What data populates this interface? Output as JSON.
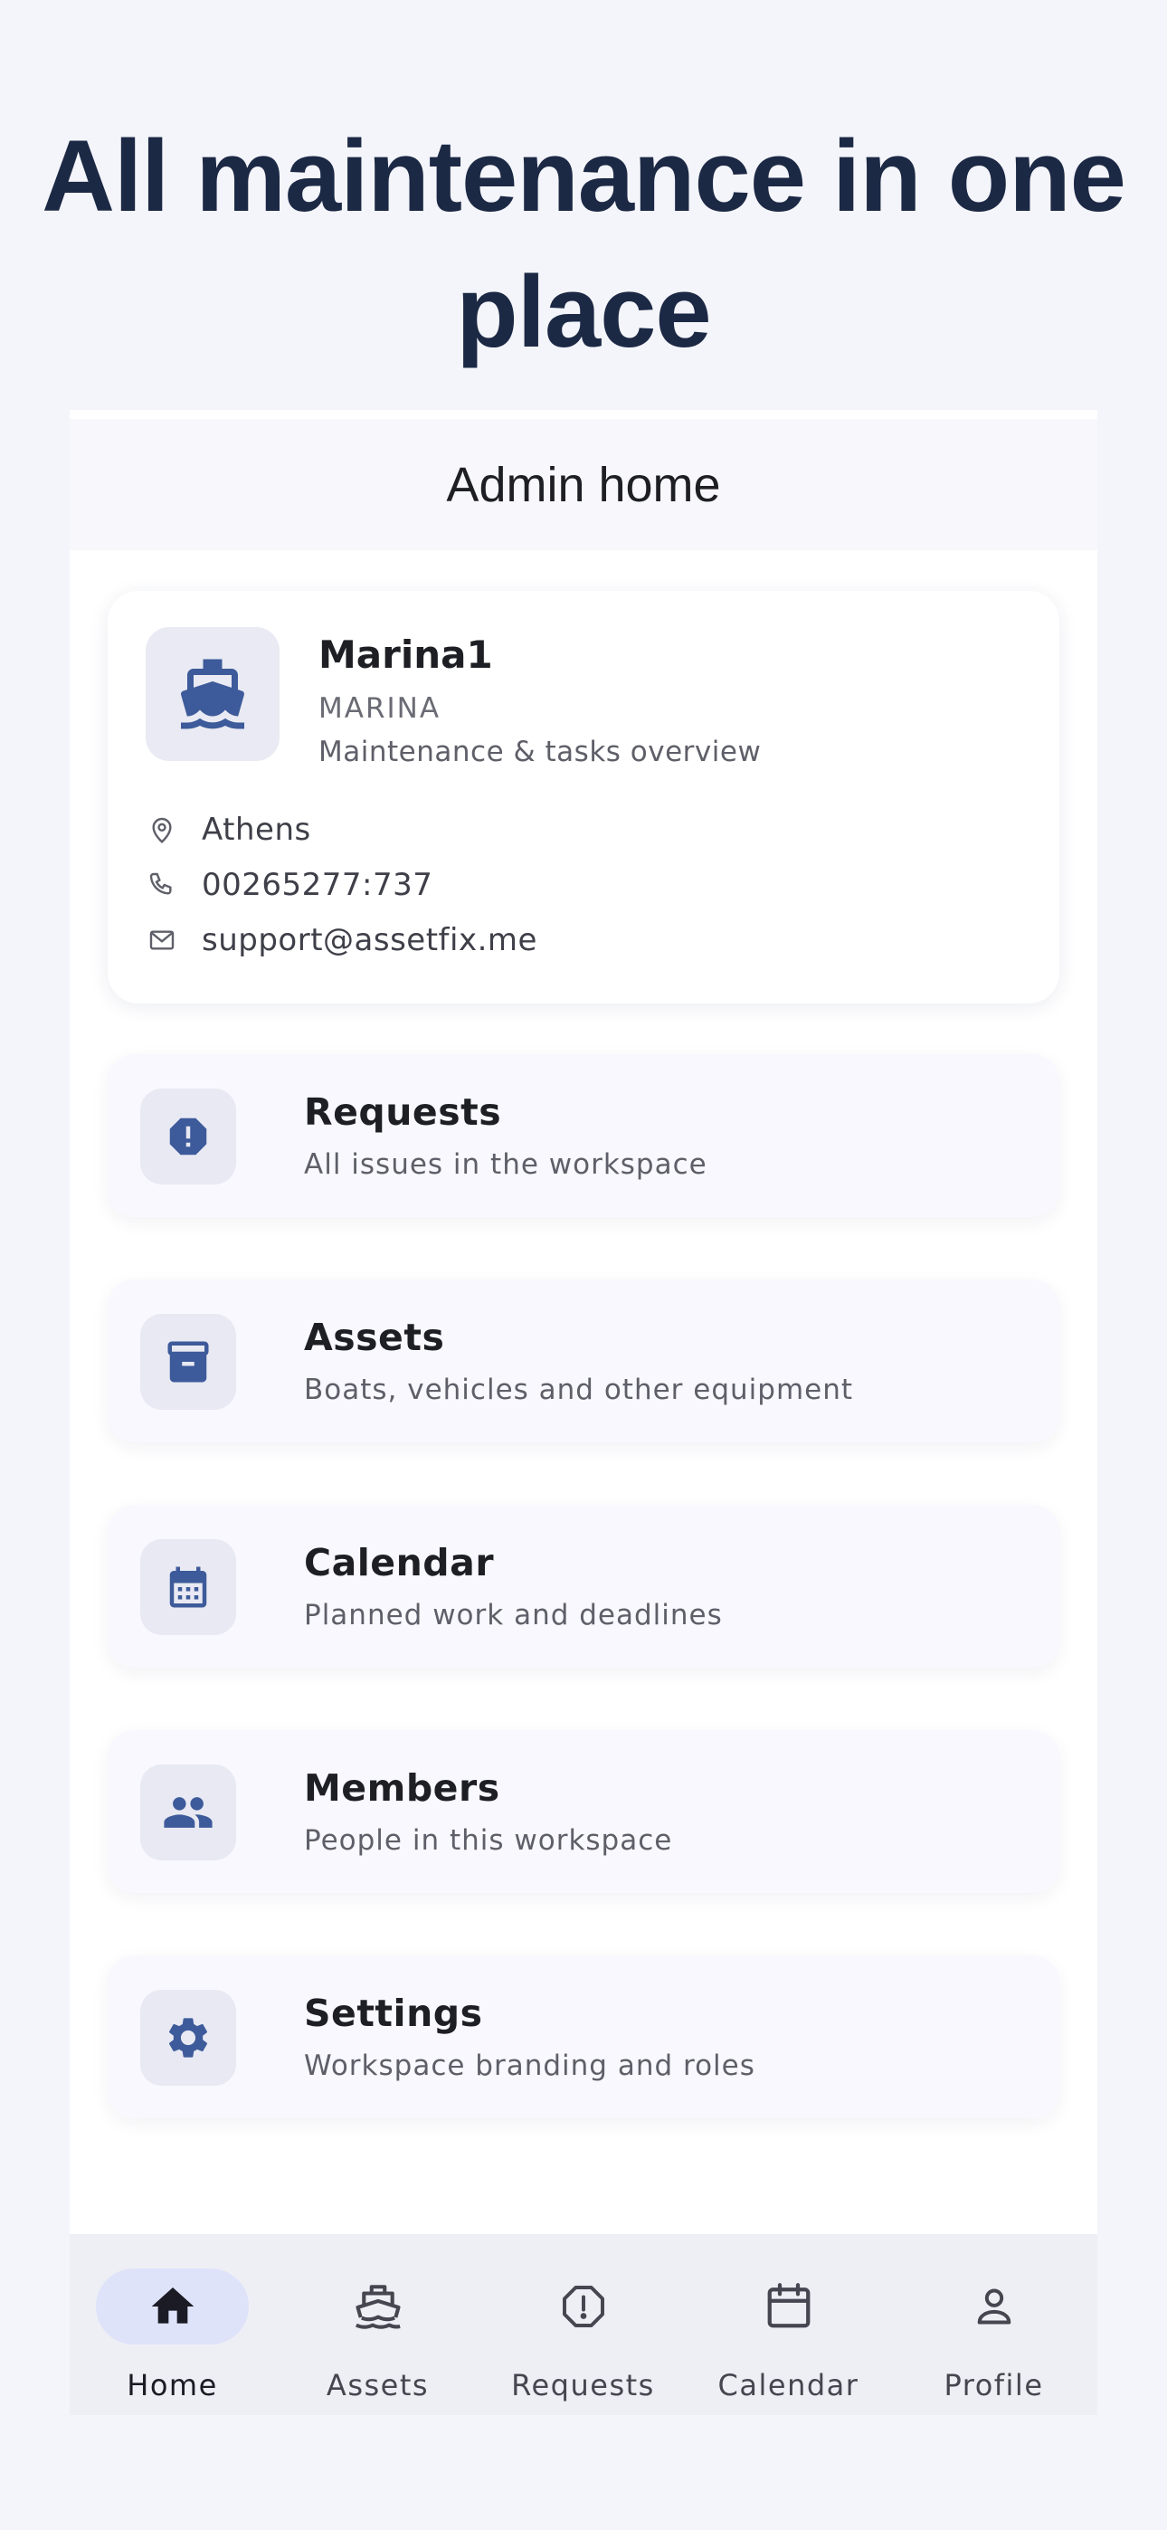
{
  "hero": {
    "title": "All maintenance in one place"
  },
  "appbar": {
    "title": "Admin home"
  },
  "workspace": {
    "name": "Marina1",
    "type": "MARINA",
    "description": "Maintenance & tasks overview",
    "location": "Athens",
    "phone": "00265277:737",
    "email": "support@assetfix.me",
    "logo_icon": "ship-icon"
  },
  "menu": [
    {
      "title": "Requests",
      "subtitle": "All issues in the workspace",
      "icon": "alert-octagon-icon"
    },
    {
      "title": "Assets",
      "subtitle": "Boats, vehicles and other equipment",
      "icon": "archive-box-icon"
    },
    {
      "title": "Calendar",
      "subtitle": "Planned work and deadlines",
      "icon": "calendar-icon"
    },
    {
      "title": "Members",
      "subtitle": "People in this workspace",
      "icon": "people-icon"
    },
    {
      "title": "Settings",
      "subtitle": "Workspace branding and roles",
      "icon": "gear-icon"
    }
  ],
  "nav": [
    {
      "label": "Home",
      "icon": "home-icon",
      "active": true
    },
    {
      "label": "Assets",
      "icon": "ship-icon",
      "active": false
    },
    {
      "label": "Requests",
      "icon": "alert-octagon-icon",
      "active": false
    },
    {
      "label": "Calendar",
      "icon": "calendar-icon",
      "active": false
    },
    {
      "label": "Profile",
      "icon": "person-icon",
      "active": false
    }
  ],
  "colors": {
    "accent": "#3d5a9a",
    "hero_text": "#1c2945",
    "active_pill": "#dfe3fa",
    "navbar_bg": "#eeeef5"
  }
}
